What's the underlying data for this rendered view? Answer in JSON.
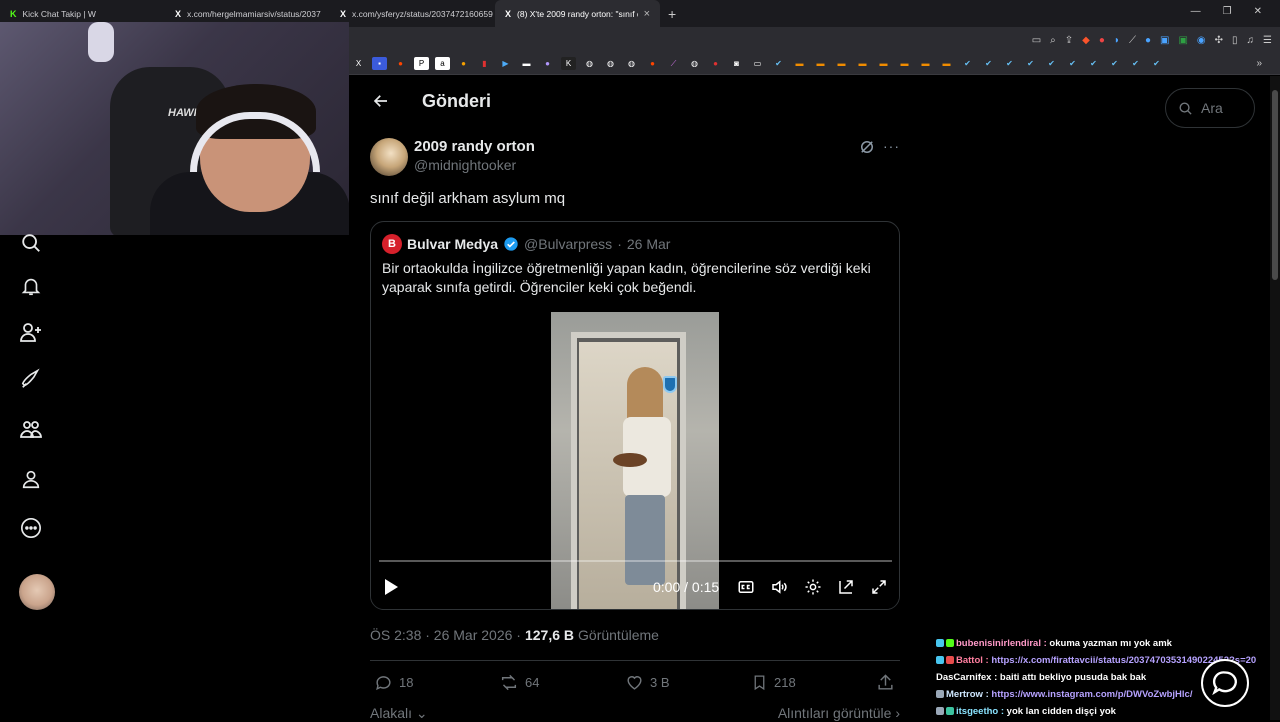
{
  "browser": {
    "tabs": [
      {
        "label": "Kick Chat Takip | W",
        "fav": "K"
      },
      {
        "label": "x.com/hergelmamiarsiv/status/2037",
        "fav": "X"
      },
      {
        "label": "x.com/ysferyz/status/2037472160659",
        "fav": "X"
      },
      {
        "label": "(8) X'te 2009 randy orton: \"sınıf d",
        "fav": "X",
        "close": "×"
      }
    ],
    "newtab": "+"
  },
  "sidebar": {
    "icons": [
      "search-icon",
      "bell-icon",
      "add-user-icon",
      "rocket-icon",
      "communities-icon",
      "profile-icon",
      "more-icon"
    ]
  },
  "header": {
    "title": "Gönderi",
    "search_placeholder": "Ara"
  },
  "post": {
    "name": "2009 randy orton",
    "handle": "@midnightooker",
    "text": "sınıf değil arkham asylum mq",
    "meta": {
      "time": "ÖS 2:38 · 26 Mar 2026 ·",
      "views": "127,6 B",
      "views_label": "Görüntüleme"
    },
    "actions": {
      "replies": "18",
      "reposts": "64",
      "likes": "3 B",
      "bookmarks": "218"
    },
    "footer_left": "Alakalı",
    "footer_right": "Alıntıları görüntüle"
  },
  "quote": {
    "name": "Bulvar Medya",
    "handle": "@Bulvarpress",
    "date": "26 Mar",
    "logo": "B",
    "text": "Bir ortaokulda İngilizce öğretmenliği yapan kadın, öğrencilerine söz verdiği keki yaparak sınıfa getirdi. Öğrenciler keki çok beğendi.",
    "video": {
      "time": "0:00 / 0:15",
      "progress": 0
    }
  },
  "chat": [
    {
      "user": "bubenisinirlendiral :",
      "msg": " okuma yazman mı yok amk",
      "badge": "#48c6ef"
    },
    {
      "user": "Battol :",
      "msg": "",
      "link": " https://x.com/firattavcii/status/2037470353149022452?s=20",
      "badge": "#e84c4c"
    },
    {
      "user": "DasCarnifex :",
      "msg": " baiti attı bekliyo pusuda bak bak",
      "badge": ""
    },
    {
      "user": "Mertrow :",
      "msg": "",
      "link": " https://www.instagram.com/p/DWVoZwbjHlc/",
      "badge": "#9aa8b8"
    },
    {
      "user": "itsgeetho :",
      "msg": " yok lan cidden dişçi yok",
      "badge": "#3cc3a0"
    }
  ],
  "colors": {
    "accent": "#1d9bf0",
    "verified": "#1d9bf0",
    "bulvar_red": "#d6202b"
  }
}
